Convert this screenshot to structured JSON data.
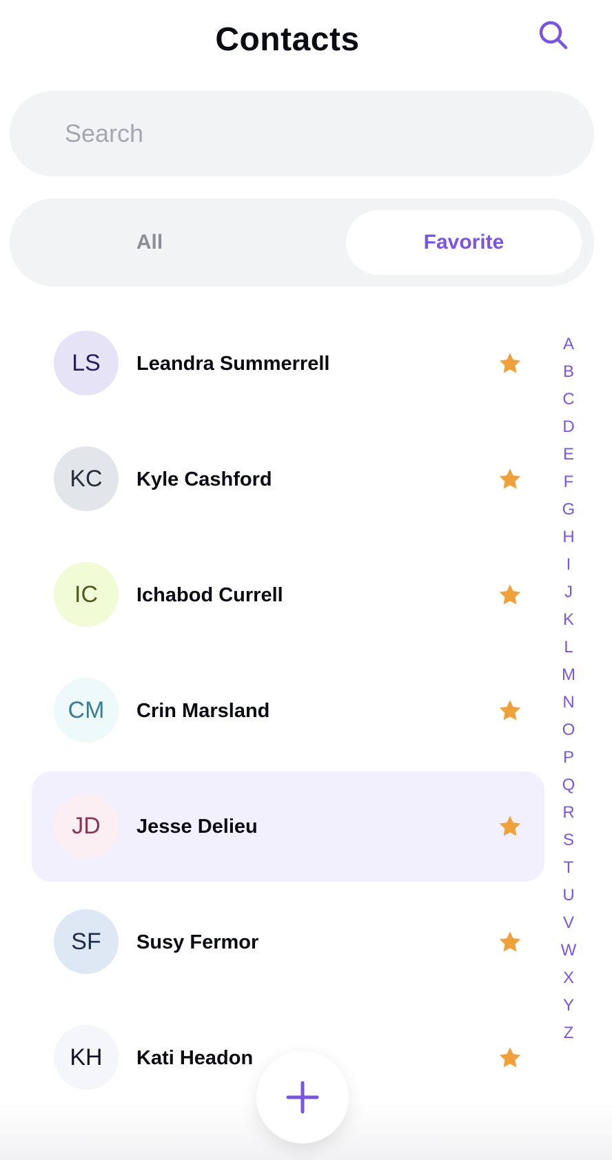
{
  "header": {
    "title": "Contacts",
    "search_icon": "search-icon"
  },
  "search": {
    "placeholder": "Search",
    "value": ""
  },
  "tabs": [
    {
      "label": "All",
      "selected": false
    },
    {
      "label": "Favorite",
      "selected": true
    }
  ],
  "contacts": [
    {
      "initials": "LS",
      "name": "Leandra Summerrell",
      "favorite": true,
      "avatar_bg": "#e6e3f6",
      "avatar_fg": "#251d5e",
      "selected": false
    },
    {
      "initials": "KC",
      "name": "Kyle Cashford",
      "favorite": true,
      "avatar_bg": "#e2e6ea",
      "avatar_fg": "#252d38",
      "selected": false
    },
    {
      "initials": "IC",
      "name": "Ichabod Currell",
      "favorite": true,
      "avatar_bg": "#f1fbd6",
      "avatar_fg": "#4b5e1f",
      "selected": false
    },
    {
      "initials": "CM",
      "name": "Crin Marsland",
      "favorite": true,
      "avatar_bg": "#eef9fa",
      "avatar_fg": "#3a7d96",
      "selected": false
    },
    {
      "initials": "JD",
      "name": "Jesse Delieu",
      "favorite": true,
      "avatar_bg": "#fbeff3",
      "avatar_fg": "#8a3456",
      "selected": true
    },
    {
      "initials": "SF",
      "name": "Susy Fermor",
      "favorite": true,
      "avatar_bg": "#dde8f4",
      "avatar_fg": "#1e2d4c",
      "selected": false
    },
    {
      "initials": "KH",
      "name": "Kati Headon",
      "favorite": true,
      "avatar_bg": "#f5f6fa",
      "avatar_fg": "#0d1226",
      "selected": false
    }
  ],
  "alphabet_index": [
    "A",
    "B",
    "C",
    "D",
    "E",
    "F",
    "G",
    "H",
    "I",
    "J",
    "K",
    "L",
    "M",
    "N",
    "O",
    "P",
    "Q",
    "R",
    "S",
    "T",
    "U",
    "V",
    "W",
    "X",
    "Y",
    "Z"
  ],
  "fab": {
    "icon": "plus-icon"
  },
  "colors": {
    "accent": "#7a55e0",
    "star": "#f0a13a",
    "surface": "#f2f3f5",
    "selected_row": "#f3f0fd"
  }
}
